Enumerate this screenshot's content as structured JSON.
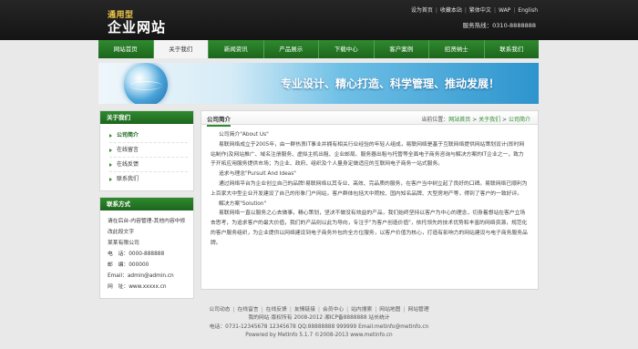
{
  "header": {
    "logo_small": "通用型",
    "logo_big": "企业网站",
    "top_links": [
      "设为首页",
      "收藏本站",
      "繁体中文",
      "WAP",
      "English"
    ],
    "phone": "服务热线：0310-8888888"
  },
  "nav": {
    "items": [
      "网站首页",
      "关于我们",
      "新闻资讯",
      "产品展示",
      "下载中心",
      "客户案例",
      "招贤纳士",
      "联系我们"
    ],
    "active": "关于我们"
  },
  "banner": {
    "slogan": "专业设计、精心打造、科学管理、推动发展！"
  },
  "sidebar": {
    "title": "关于我们",
    "items": [
      "公司简介",
      "在线留言",
      "在线反馈",
      "联系我们"
    ],
    "active": "公司简介"
  },
  "contact": {
    "title": "联系方式",
    "lines": [
      "请在后台-内容管理-其他内容中修",
      "改此段文字",
      "某某有限公司",
      "电　话：0000-888888",
      "邮　编：000000",
      "Email：admin@admin.cn",
      "网　址：www.xxxxx.cn"
    ]
  },
  "main": {
    "tab_title": "公司简介",
    "breadcrumb_prefix": "当前位置：",
    "breadcrumb": [
      "网站首页",
      "关于我们",
      "公司简介"
    ],
    "breadcrumb_sep": " > ",
    "paragraphs": [
      "公司简介\"About Us\"",
      "易联网络成立于2005年，由一群热衷IT事业并拥有相关行业经验的年轻人组成，易联网络是基于互联网络提供网站策划设计(即时网站制作)及网站推广、域名注册服务、虚拟主机出租、企业邮局、服务器出租与托管等全面电子商务咨询与解决方案的IT企业之一，致力于开拓应用服务提供市场；为企业、政府、组织及个人量身定做适应的互联网电子商务一站式服务。",
      "追求与理念\"Pursuit And Ideas\"",
      "通过网络平台为企业创立自己的品牌!易联网络以其专业、高效、完品质的服务，在客户当中树立起了良好的口碑。易联网络已顺利为上百家大中型企业开发建设了自己的形象门户网站，客户群体包括大中院校、国内知名品牌、大型房地产等，得到了客户的一致好评。",
      "解决方案\"Solution\"",
      "易联网络一直以服务之心去做事，精心策划，坚决不做没有效益的产品，我们始终坚持以客户为中心的理念，切身着想站在客户立场去思考，为追求客户的最大价值，我们的产品则以此为导向，专注于\"为客户创造价值\"，依托领先的技术优势和丰富的网络资源，规范化的客户服务组织，为企业提供以网络建设到电子商务外包的全方位服务，以客户价值为核心，打造有影响力的网站建设与电子商务服务品牌。"
    ]
  },
  "footer": {
    "links": [
      "公司动态",
      "在线留言",
      "在线反馈",
      "友情链接",
      "会员中心",
      "站内搜索",
      "网站地图",
      "网站管理"
    ],
    "line2": "我的网站 版权所有 2008-2012 湘ICP备8888888 站长统计",
    "line3": "电话：0731-12345678 12345678 QQ:88888888 999999 Email:metinfo@metinfo.cn",
    "line4": "Powered by MetInfo 5.1.7 ©2008-2013  www.metinfo.cn"
  },
  "colors": {
    "green": "#2f8a2f",
    "dark_green": "#1d661d",
    "header_bg": "#1a1a1a",
    "logo_yellow": "#f2c94c"
  }
}
